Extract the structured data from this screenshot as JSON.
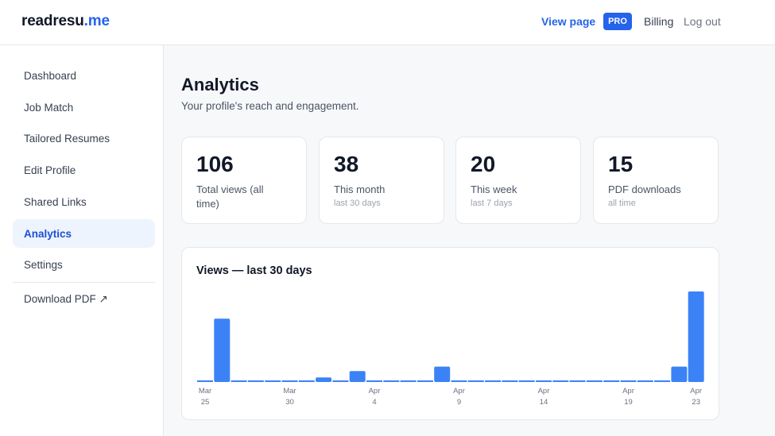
{
  "header": {
    "logo_main": "readresu",
    "logo_tld": ".me",
    "view_page": "View page",
    "badge": "PRO",
    "billing": "Billing",
    "logout": "Log out"
  },
  "sidebar": {
    "items": [
      {
        "label": "Dashboard"
      },
      {
        "label": "Job Match"
      },
      {
        "label": "Tailored Resumes"
      },
      {
        "label": "Edit Profile"
      },
      {
        "label": "Shared Links"
      },
      {
        "label": "Analytics",
        "active": true
      },
      {
        "label": "Settings"
      }
    ],
    "download": "Download PDF ↗"
  },
  "main": {
    "title": "Analytics",
    "subtitle": "Your profile's reach and engagement.",
    "stats": [
      {
        "value": "106",
        "label": "Total views (all time)",
        "sub": ""
      },
      {
        "value": "38",
        "label": "This month",
        "sub": "last 30 days"
      },
      {
        "value": "20",
        "label": "This week",
        "sub": "last 7 days"
      },
      {
        "value": "15",
        "label": "PDF downloads",
        "sub": "all time"
      }
    ],
    "chart_title": "Views — last 30 days"
  },
  "colors": {
    "accent": "#2563eb",
    "bar": "#3b82f6",
    "active_nav_bg": "#eef4fd"
  },
  "chart_data": {
    "type": "bar",
    "title": "Views — last 30 days",
    "categories": [
      "Mar 25",
      "Mar 26",
      "Mar 27",
      "Mar 28",
      "Mar 29",
      "Mar 30",
      "Mar 31",
      "Apr 1",
      "Apr 2",
      "Apr 3",
      "Apr 4",
      "Apr 5",
      "Apr 6",
      "Apr 7",
      "Apr 8",
      "Apr 9",
      "Apr 10",
      "Apr 11",
      "Apr 12",
      "Apr 13",
      "Apr 14",
      "Apr 15",
      "Apr 16",
      "Apr 17",
      "Apr 18",
      "Apr 19",
      "Apr 20",
      "Apr 21",
      "Apr 22",
      "Apr 23"
    ],
    "values": [
      0,
      7,
      0,
      0,
      0,
      0,
      0,
      0.5,
      0,
      1.2,
      0,
      0,
      0,
      0,
      1.7,
      0,
      0,
      0,
      0,
      0,
      0,
      0,
      0,
      0,
      0,
      0,
      0,
      0,
      1.7,
      10
    ],
    "tick_labels": [
      {
        "month": "Mar",
        "day": "25",
        "index": 0
      },
      {
        "month": "Mar",
        "day": "30",
        "index": 5
      },
      {
        "month": "Apr",
        "day": "4",
        "index": 10
      },
      {
        "month": "Apr",
        "day": "9",
        "index": 15
      },
      {
        "month": "Apr",
        "day": "14",
        "index": 20
      },
      {
        "month": "Apr",
        "day": "19",
        "index": 25
      },
      {
        "month": "Apr",
        "day": "23",
        "index": 29
      }
    ],
    "ylim": [
      0,
      10
    ],
    "grid": false
  }
}
